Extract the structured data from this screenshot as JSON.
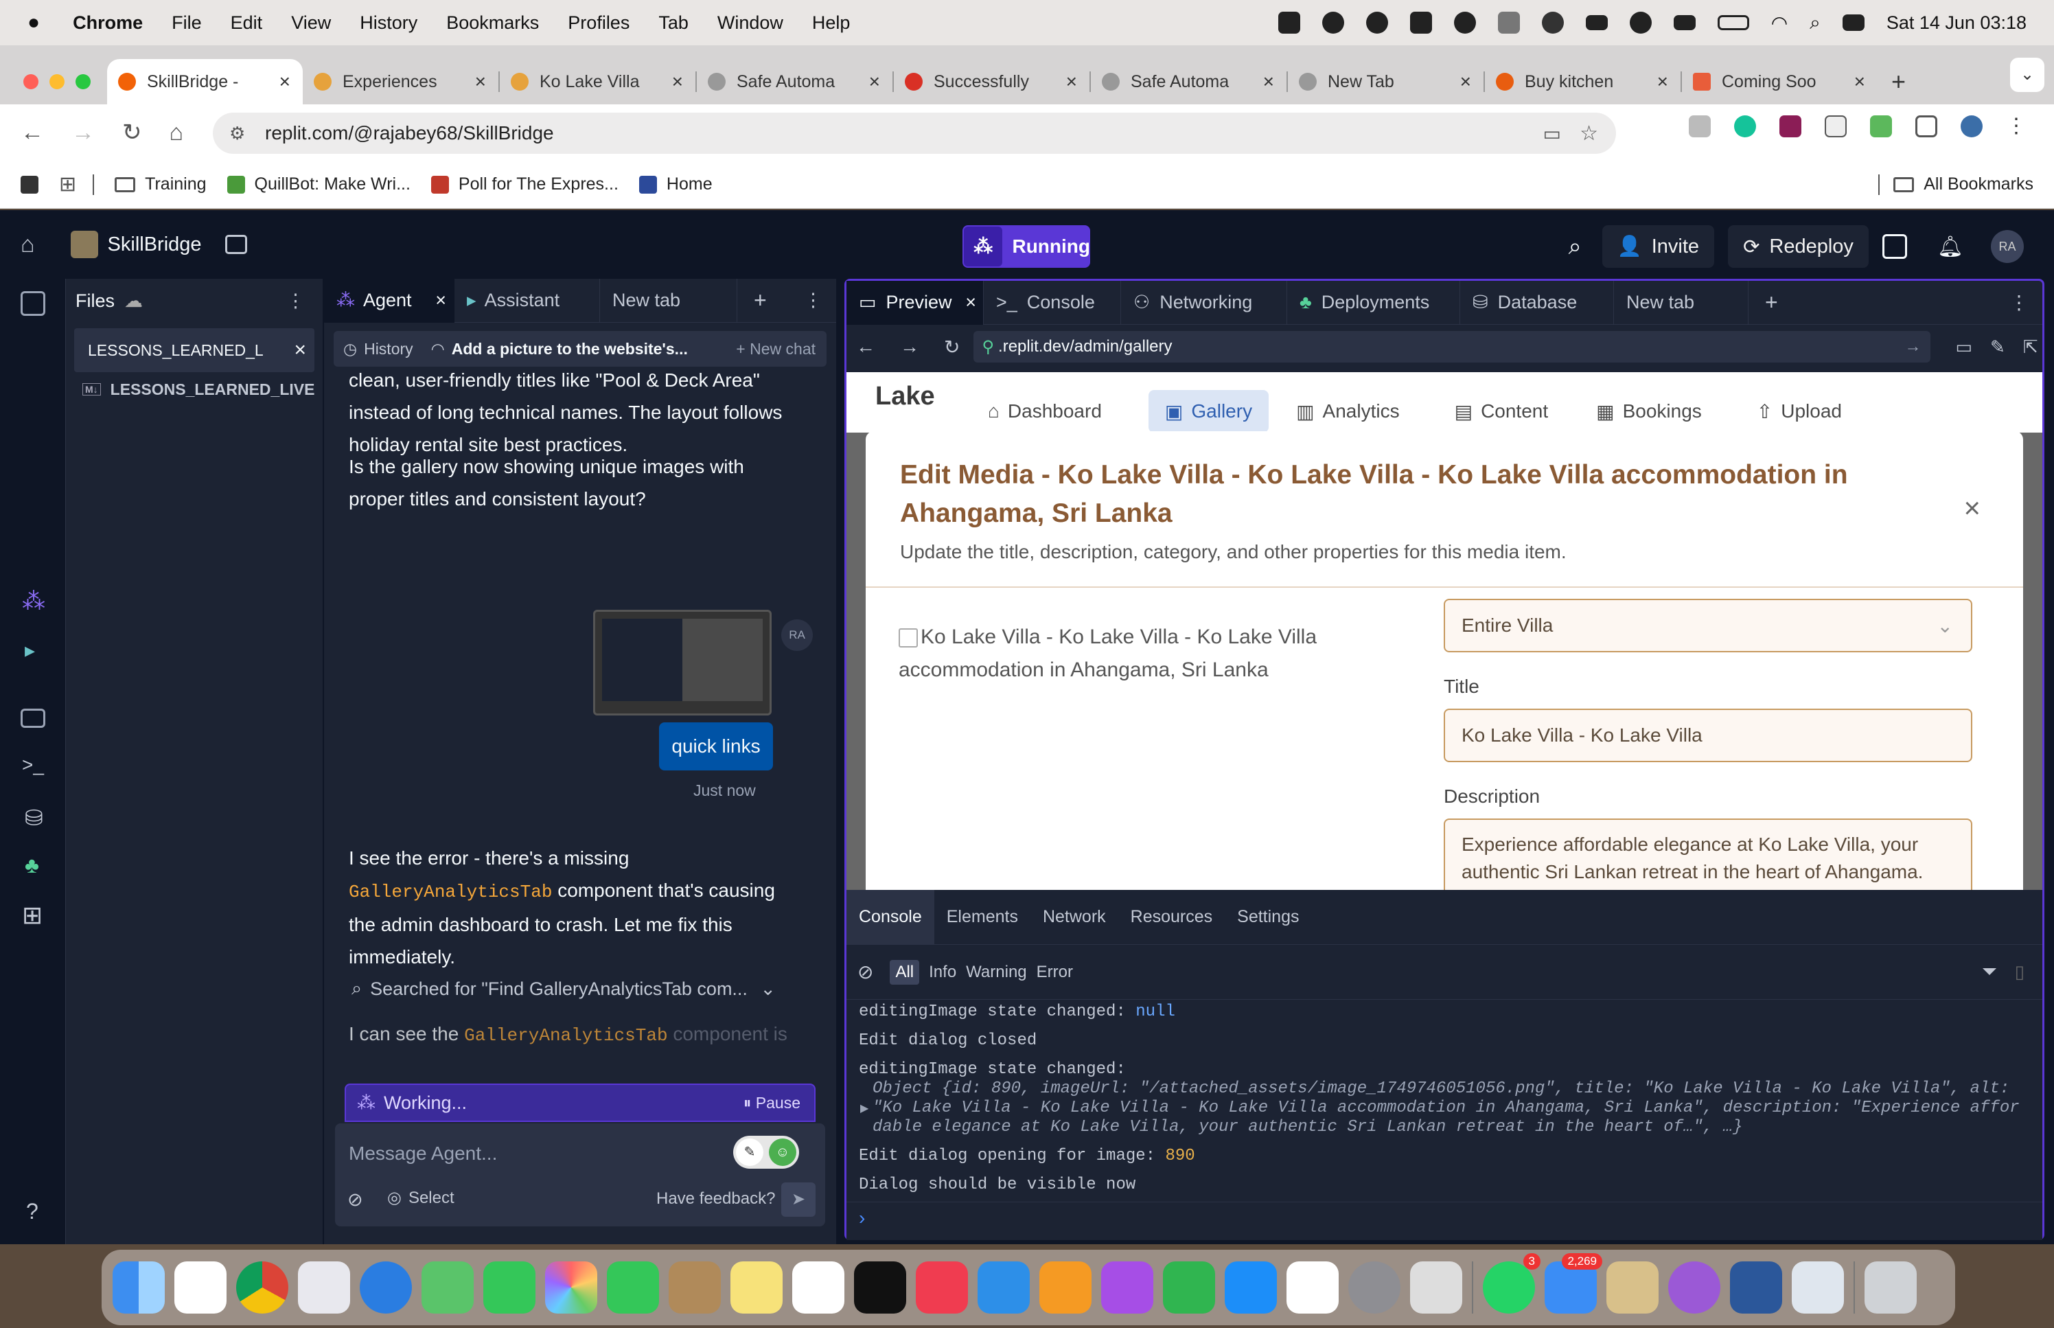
{
  "menubar": {
    "app": "Chrome",
    "items": [
      "File",
      "Edit",
      "View",
      "History",
      "Bookmarks",
      "Profiles",
      "Tab",
      "Window",
      "Help"
    ],
    "clock": "Sat 14 Jun  03:18"
  },
  "browser": {
    "tabs": [
      {
        "label": "SkillBridge -",
        "active": true
      },
      {
        "label": "Experiences"
      },
      {
        "label": "Ko Lake Villa"
      },
      {
        "label": "Safe Automa"
      },
      {
        "label": "Successfully"
      },
      {
        "label": "Safe Automa"
      },
      {
        "label": "New Tab"
      },
      {
        "label": "Buy kitchen"
      },
      {
        "label": "Coming Soo"
      }
    ],
    "url": "replit.com/@rajabey68/SkillBridge",
    "bookmarks": [
      "Training",
      "QuillBot: Make Wri...",
      "Poll for The Expres...",
      "Home"
    ],
    "all_bookmarks": "All Bookmarks"
  },
  "replit": {
    "project": "SkillBridge",
    "status": "Running",
    "invite": "Invite",
    "redeploy": "Redeploy",
    "avatar": "RA",
    "files": {
      "title": "Files",
      "open_tab": "LESSONS_LEARNED_L",
      "file": "LESSONS_LEARNED_LIVE"
    },
    "agent_tabs": [
      "Agent",
      "Assistant",
      "New tab"
    ],
    "history": "History",
    "chat_title": "Add a picture to the website's...",
    "new_chat": "New chat",
    "messages": {
      "m1": "clean, user-friendly titles like \"Pool & Deck Area\" instead of long technical names. The layout follows holiday rental site best practices.",
      "m2": "Is the gallery now showing unique images with proper titles and consistent layout?",
      "user_msg": "quick links",
      "time": "Just now",
      "m3a": "I see the error - there's a missing",
      "m3code": "GalleryAnalyticsTab",
      "m3b": "component that's causing the admin dashboard to crash. Let me fix this immediately.",
      "search": "Searched for \"Find GalleryAnalyticsTab com...",
      "m4a": "I can see the",
      "m4code": "GalleryAnalyticsTab",
      "m4b": "component is"
    },
    "working": "Working...",
    "pause": "Pause",
    "input_placeholder": "Message Agent...",
    "select": "Select",
    "feedback": "Have feedback?",
    "preview_tabs": [
      "Preview",
      "Console",
      "Networking",
      "Deployments",
      "Database",
      "New tab"
    ],
    "preview_url": ".replit.dev/admin/gallery",
    "site": {
      "logo": "Lake",
      "nav": [
        "Dashboard",
        "Gallery",
        "Analytics",
        "Content",
        "Bookings",
        "Upload"
      ]
    },
    "modal": {
      "title": "Edit Media - Ko Lake Villa - Ko Lake Villa - Ko Lake Villa accommodation in Ahangama, Sri Lanka",
      "subtitle": "Update the title, description, category, and other properties for this media item.",
      "image_alt": "Ko Lake Villa - Ko Lake Villa - Ko Lake Villa accommodation in Ahangama, Sri Lanka",
      "category_value": "Entire Villa",
      "title_label": "Title",
      "title_value": "Ko Lake Villa - Ko Lake Villa",
      "desc_label": "Description",
      "desc_value": "Experience affordable elegance at Ko Lake Villa, your authentic Sri Lankan retreat in the heart of Ahangama."
    },
    "devtools": {
      "tabs": [
        "Console",
        "Elements",
        "Network",
        "Resources",
        "Settings"
      ],
      "filters": [
        "All",
        "Info",
        "Warning",
        "Error"
      ],
      "logs": {
        "l1a": "editingImage state changed: ",
        "l1b": "null",
        "l2": "Edit dialog closed",
        "l3": "editingImage state changed:",
        "l4": "Object {id: 890, imageUrl: \"/attached_assets/image_1749746051056.png\", title: \"Ko Lake Villa - Ko Lake Villa\", alt:",
        "l5": "\"Ko Lake Villa - Ko Lake Villa - Ko Lake Villa accommodation in Ahangama, Sri Lanka\", description: \"Experience affor",
        "l6": "dable elegance at Ko Lake Villa, your authentic Sri Lankan retreat in the heart of…\", …}",
        "l7a": "Edit dialog opening for image: ",
        "l7b": "890",
        "l8": "Dialog should be visible now"
      }
    }
  },
  "dock": {
    "badges": {
      "whatsapp": "3",
      "mail": "2,269"
    }
  },
  "colors": {
    "accent": "#5a37d6",
    "modal_title": "#8a5a34",
    "input_border": "#c79a60"
  }
}
